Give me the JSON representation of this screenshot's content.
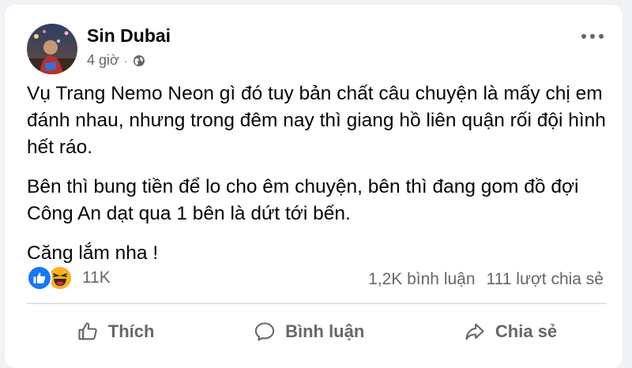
{
  "post": {
    "author": "Sin Dubai",
    "time": "4 giờ",
    "separator": "·",
    "privacy_icon": "globe-icon",
    "paragraphs": [
      "Vụ Trang Nemo Neon gì đó tuy bản chất câu chuyện là mấy chị em đánh nhau, nhưng trong đêm nay thì giang hồ liên quận rối đội hình hết ráo.",
      "Bên thì bung tiền để lo cho êm chuyện, bên thì đang gom đồ đợi Công An dạt qua 1 bên là dứt tới bến.",
      "Căng lắm nha !"
    ]
  },
  "reactions": {
    "icons": [
      "like-reaction-icon",
      "haha-reaction-icon"
    ],
    "count": "11K",
    "comments": "1,2K bình luận",
    "shares": "111 lượt chia sẻ"
  },
  "actions": {
    "like": "Thích",
    "comment": "Bình luận",
    "share": "Chia sẻ"
  },
  "colors": {
    "like_blue": "#1877f2",
    "haha_yellow": "#f7b125",
    "secondary_text": "#65676b"
  }
}
